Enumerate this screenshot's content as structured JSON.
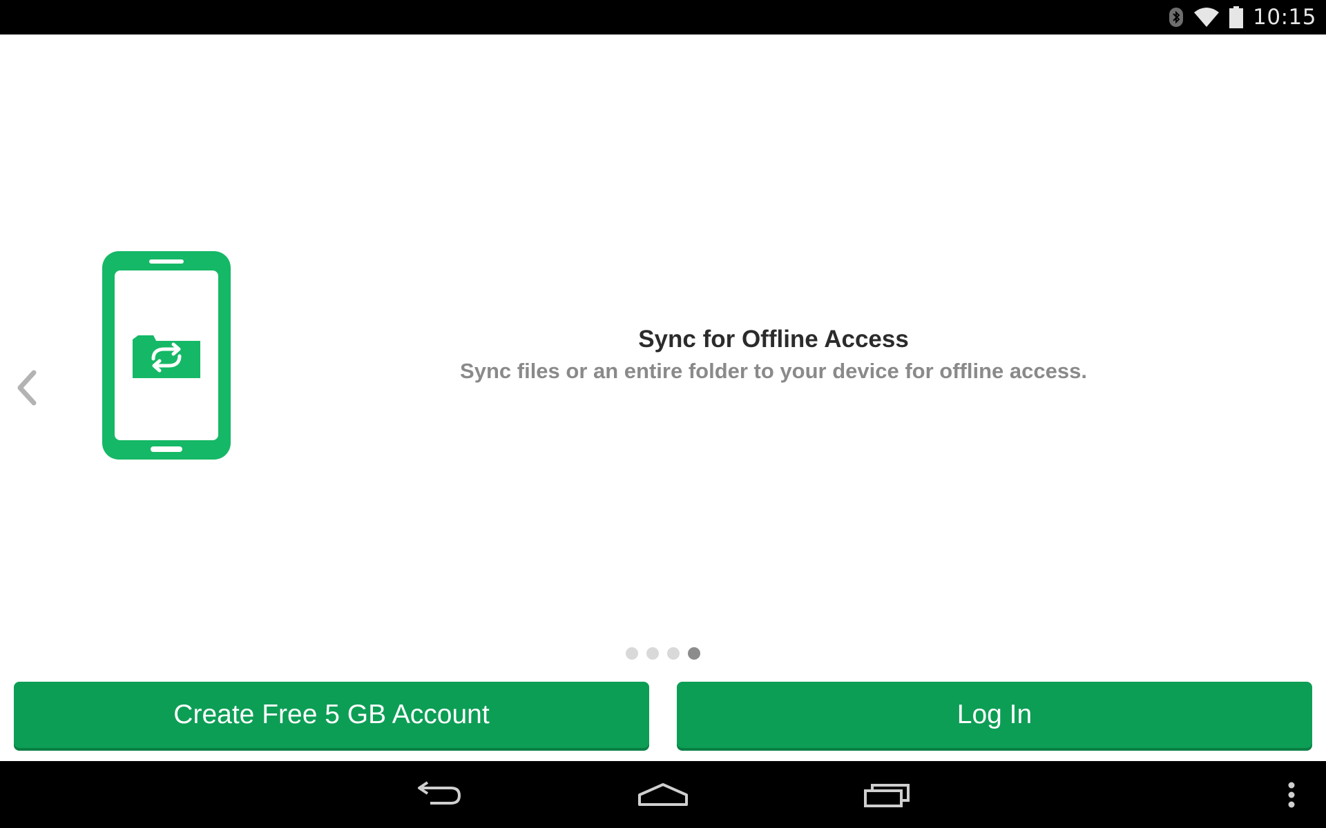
{
  "status_bar": {
    "time": "10:15",
    "icons": [
      "bluetooth-icon",
      "wifi-icon",
      "battery-icon"
    ]
  },
  "slide": {
    "illustration": "phone-sync-folder-illustration",
    "title": "Sync for Offline Access",
    "description": "Sync files or an entire folder to your device for offline access."
  },
  "carousel": {
    "prev_icon": "chevron-left-icon",
    "page_count": 4,
    "active_page": 4
  },
  "buttons": {
    "create_label": "Create Free 5 GB Account",
    "login_label": "Log In"
  },
  "nav_bar": {
    "icons": [
      "back-icon",
      "home-icon",
      "recents-icon",
      "overflow-menu-icon"
    ]
  },
  "colors": {
    "accent": "#0d9e55",
    "illustration_green": "#15b866",
    "status_bar_bg": "#000000",
    "title_text": "#2b2b2b",
    "description_text": "#8a8a8a"
  }
}
